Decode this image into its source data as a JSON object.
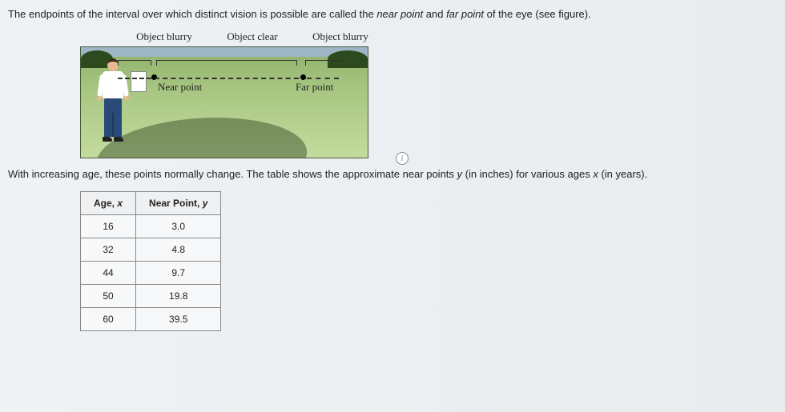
{
  "intro": {
    "pre": "The endpoints of the interval over which distinct vision is possible are called the ",
    "np": "near point",
    "mid": " and ",
    "fp": "far point",
    "post": " of the eye (see figure)."
  },
  "figure": {
    "top_labels": {
      "blurry1": "Object blurry",
      "clear": "Object clear",
      "blurry2": "Object blurry"
    },
    "near": "Near point",
    "far": "Far point",
    "info": "i"
  },
  "mid": {
    "pre": "With increasing age, these points normally change. The table shows the approximate near points ",
    "y": "y",
    "mid1": " (in inches) for various ages ",
    "x": "x",
    "post": " (in years)."
  },
  "table": {
    "headers": {
      "age_lbl": "Age, ",
      "age_var": "x",
      "np_lbl": "Near Point, ",
      "np_var": "y"
    },
    "rows": [
      {
        "age": "16",
        "np": "3.0"
      },
      {
        "age": "32",
        "np": "4.8"
      },
      {
        "age": "44",
        "np": "9.7"
      },
      {
        "age": "50",
        "np": "19.8"
      },
      {
        "age": "60",
        "np": "39.5"
      }
    ]
  }
}
